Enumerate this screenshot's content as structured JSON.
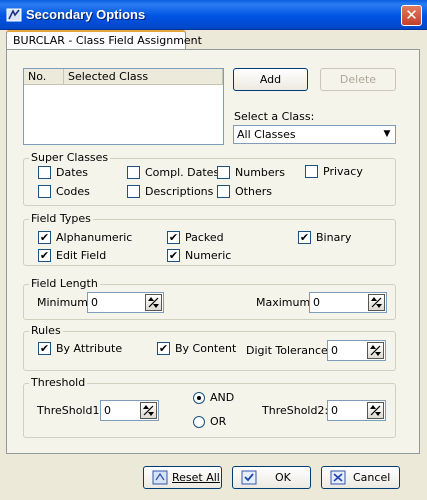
{
  "window": {
    "title": "Secondary Options",
    "close_glyph": "✕"
  },
  "tab": {
    "label": "BURCLAR - Class Field Assignment"
  },
  "class_list": {
    "columns": [
      "No.",
      "Selected Class"
    ],
    "rows": []
  },
  "buttons": {
    "add": "Add",
    "delete": "Delete"
  },
  "select_class": {
    "label": "Select a Class:",
    "value": "All Classes"
  },
  "super_classes": {
    "title": "Super Classes",
    "items": [
      {
        "label": "Dates",
        "checked": false
      },
      {
        "label": "Compl. Dates",
        "checked": false
      },
      {
        "label": "Numbers",
        "checked": false
      },
      {
        "label": "Privacy",
        "checked": false
      },
      {
        "label": "Codes",
        "checked": false
      },
      {
        "label": "Descriptions",
        "checked": false
      },
      {
        "label": "Others",
        "checked": false
      }
    ]
  },
  "field_types": {
    "title": "Field Types",
    "items": [
      {
        "label": "Alphanumeric",
        "checked": true
      },
      {
        "label": "Packed",
        "checked": true
      },
      {
        "label": "Binary",
        "checked": true
      },
      {
        "label": "Edit Field",
        "checked": true
      },
      {
        "label": "Numeric",
        "checked": true
      }
    ]
  },
  "field_length": {
    "title": "Field Length",
    "minimum_label": "Minimum:",
    "minimum_value": "0",
    "maximum_label": "Maximum:",
    "maximum_value": "0"
  },
  "rules": {
    "title": "Rules",
    "by_attribute": {
      "label": "By Attribute",
      "checked": true
    },
    "by_content": {
      "label": "By Content",
      "checked": true
    },
    "digit_tolerance_label": "Digit Tolerance",
    "digit_tolerance_value": "0"
  },
  "threshold": {
    "title": "Threshold",
    "threshold1_label": "ThreShold1:",
    "threshold1_value": "0",
    "threshold2_label": "ThreShold2:",
    "threshold2_value": "0",
    "and_label": "AND",
    "or_label": "OR",
    "selected": "AND"
  },
  "footer": {
    "reset_all": "Reset All",
    "ok": "OK",
    "cancel": "Cancel"
  },
  "colors": {
    "title_bar": "#0054e3",
    "window_bg": "#ece9d8",
    "close_button": "#c1412a"
  }
}
